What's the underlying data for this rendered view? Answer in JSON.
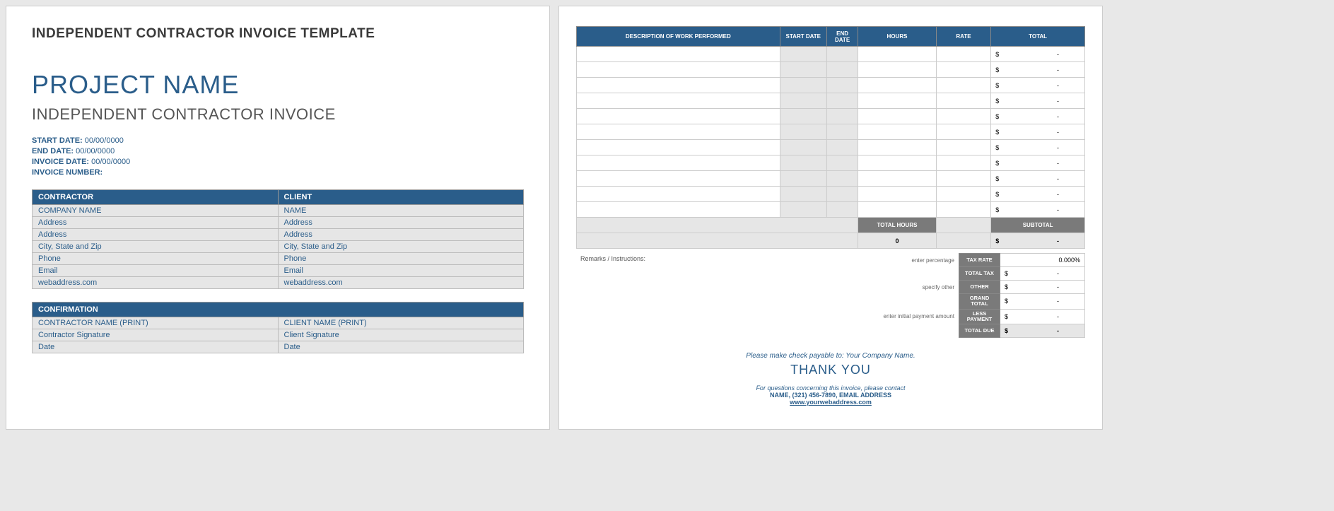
{
  "left": {
    "title": "INDEPENDENT CONTRACTOR INVOICE TEMPLATE",
    "project_name": "PROJECT NAME",
    "subtitle": "INDEPENDENT CONTRACTOR INVOICE",
    "meta": {
      "start_label": "START DATE:",
      "start_val": "00/00/0000",
      "end_label": "END DATE:",
      "end_val": "00/00/0000",
      "invdate_label": "INVOICE DATE:",
      "invdate_val": "00/00/0000",
      "invnum_label": "INVOICE NUMBER:",
      "invnum_val": ""
    },
    "contractor_header": "CONTRACTOR",
    "client_header": "CLIENT",
    "contractor_rows": [
      "COMPANY NAME",
      "Address",
      "Address",
      "City, State and Zip",
      "Phone",
      "Email",
      "webaddress.com"
    ],
    "client_rows": [
      "NAME",
      "Address",
      "Address",
      "City, State and Zip",
      "Phone",
      "Email",
      "webaddress.com"
    ],
    "confirmation_header": "CONFIRMATION",
    "conf_left": [
      "CONTRACTOR NAME (PRINT)",
      "Contractor Signature",
      "Date"
    ],
    "conf_right": [
      "CLIENT NAME (PRINT)",
      "Client Signature",
      "Date"
    ]
  },
  "right": {
    "headers": [
      "DESCRIPTION OF WORK PERFORMED",
      "START DATE",
      "END DATE",
      "HOURS",
      "RATE",
      "TOTAL"
    ],
    "row_count": 11,
    "dollar": "$",
    "dash": "-",
    "total_hours_label": "TOTAL HOURS",
    "total_hours_val": "0",
    "subtotal_label": "SUBTOTAL",
    "remarks_label": "Remarks / Instructions:",
    "hints": {
      "tax": "enter percentage",
      "other": "specify other",
      "less": "enter initial payment amount"
    },
    "labels": {
      "taxrate": "TAX RATE",
      "totaltax": "TOTAL TAX",
      "other": "OTHER",
      "grand": "GRAND TOTAL",
      "less": "LESS PAYMENT",
      "due": "TOTAL DUE"
    },
    "taxrate_val": "0.000%",
    "footer": {
      "payable": "Please make check payable to: Your Company Name.",
      "thanks": "THANK YOU",
      "contact_intro": "For questions concerning this invoice, please contact",
      "contact_line": "NAME, (321) 456-7890, EMAIL ADDRESS",
      "web": "www.yourwebaddress.com"
    }
  }
}
